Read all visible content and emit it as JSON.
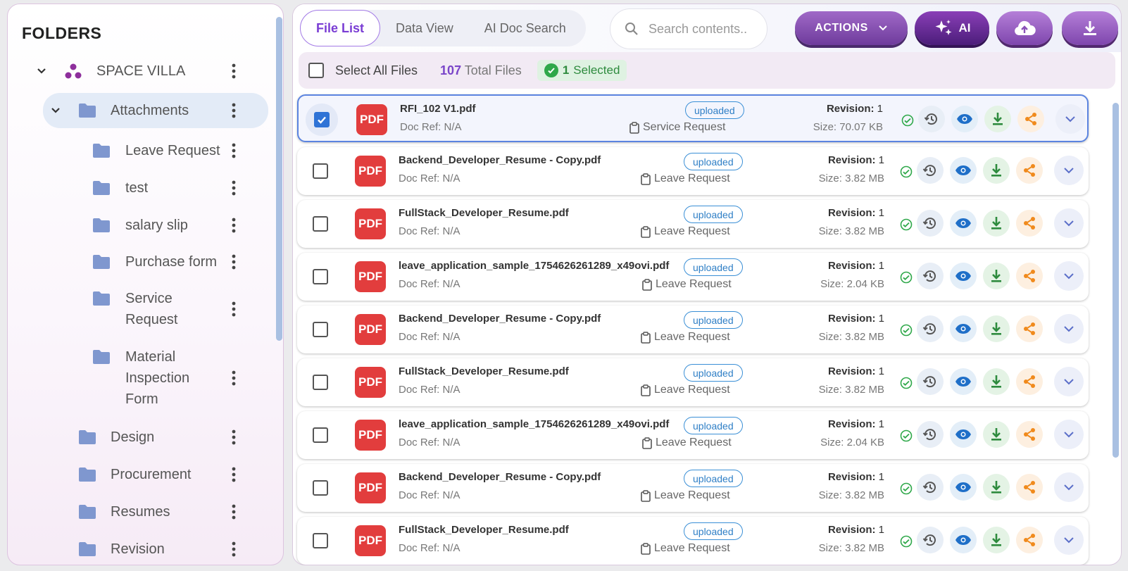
{
  "sidebar": {
    "title": "FOLDERS",
    "root": "SPACE VILLA",
    "items": [
      {
        "label": "Attachments",
        "level": 1,
        "expanded": true
      },
      {
        "label": "Leave Request",
        "level": 2
      },
      {
        "label": "test",
        "level": 2
      },
      {
        "label": "salary slip",
        "level": 2
      },
      {
        "label": "Purchase form",
        "level": 2
      },
      {
        "label": "Service\nRequest",
        "level": 2
      },
      {
        "label": "Material\nInspection\nForm",
        "level": 2
      },
      {
        "label": "Design",
        "level": 1
      },
      {
        "label": "Procurement",
        "level": 1
      },
      {
        "label": "Resumes",
        "level": 1
      },
      {
        "label": "Revision",
        "level": 1
      }
    ]
  },
  "tabs": [
    {
      "label": "File List",
      "active": true
    },
    {
      "label": "Data View",
      "active": false
    },
    {
      "label": "AI Doc Search",
      "active": false
    }
  ],
  "search": {
    "placeholder": "Search contents.."
  },
  "toolbar": {
    "actions_label": "ACTIONS",
    "ai_label": "AI"
  },
  "selection": {
    "select_all_label": "Select All Files",
    "total_count": "107",
    "total_label": "Total Files",
    "selected_count": "1",
    "selected_label": "Selected"
  },
  "labels": {
    "pdf": "PDF",
    "doc_ref": "Doc Ref: N/A",
    "revision_label": "Revision:",
    "size_prefix": "Size:"
  },
  "files": [
    {
      "name": "RFI_102 V1.pdf",
      "status": "uploaded",
      "folder": "Service Request",
      "revision": "1",
      "size": "70.07 KB",
      "selected": true
    },
    {
      "name": "Backend_Developer_Resume - Copy.pdf",
      "status": "uploaded",
      "folder": "Leave Request",
      "revision": "1",
      "size": "3.82 MB",
      "selected": false
    },
    {
      "name": "FullStack_Developer_Resume.pdf",
      "status": "uploaded",
      "folder": "Leave Request",
      "revision": "1",
      "size": "3.82 MB",
      "selected": false
    },
    {
      "name": "leave_application_sample_1754626261289_x49ovi.pdf",
      "status": "uploaded",
      "folder": "Leave Request",
      "revision": "1",
      "size": "2.04 KB",
      "selected": false
    },
    {
      "name": "Backend_Developer_Resume - Copy.pdf",
      "status": "uploaded",
      "folder": "Leave Request",
      "revision": "1",
      "size": "3.82 MB",
      "selected": false
    },
    {
      "name": "FullStack_Developer_Resume.pdf",
      "status": "uploaded",
      "folder": "Leave Request",
      "revision": "1",
      "size": "3.82 MB",
      "selected": false
    },
    {
      "name": "leave_application_sample_1754626261289_x49ovi.pdf",
      "status": "uploaded",
      "folder": "Leave Request",
      "revision": "1",
      "size": "2.04 KB",
      "selected": false
    },
    {
      "name": "Backend_Developer_Resume - Copy.pdf",
      "status": "uploaded",
      "folder": "Leave Request",
      "revision": "1",
      "size": "3.82 MB",
      "selected": false
    },
    {
      "name": "FullStack_Developer_Resume.pdf",
      "status": "uploaded",
      "folder": "Leave Request",
      "revision": "1",
      "size": "3.82 MB",
      "selected": false
    }
  ],
  "colors": {
    "accent": "#7a3dd4",
    "pdf": "#e23d3d",
    "selected_border": "#5b84e0",
    "status": "#2f7fc6"
  }
}
